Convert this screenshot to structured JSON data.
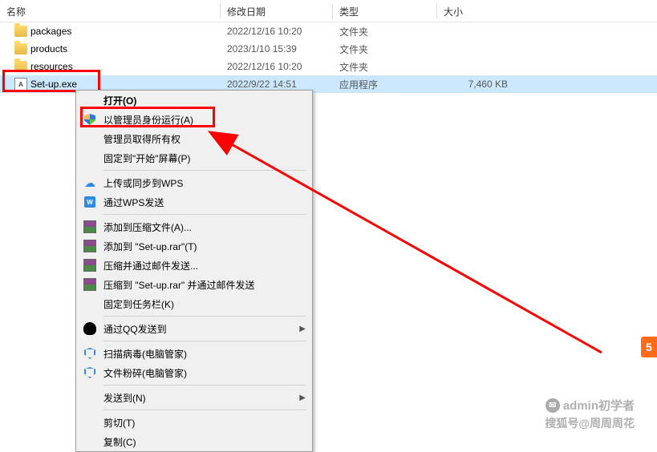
{
  "header": {
    "name": "名称",
    "date": "修改日期",
    "type": "类型",
    "size": "大小"
  },
  "files": [
    {
      "icon": "folder",
      "name": "packages",
      "date": "2022/12/16 10:20",
      "type": "文件夹",
      "size": ""
    },
    {
      "icon": "folder",
      "name": "products",
      "date": "2023/1/10 15:39",
      "type": "文件夹",
      "size": ""
    },
    {
      "icon": "folder",
      "name": "resources",
      "date": "2022/12/16 10:20",
      "type": "文件夹",
      "size": ""
    },
    {
      "icon": "exe",
      "name": "Set-up.exe",
      "date": "2022/9/22 14:51",
      "type": "应用程序",
      "size": "7,460 KB",
      "selected": true
    }
  ],
  "menu": {
    "open": "打开(O)",
    "runas": "以管理员身份运行(A)",
    "ownership": "管理员取得所有权",
    "pin_start": "固定到\"开始\"屏幕(P)",
    "upload_wps": "上传或同步到WPS",
    "send_wps": "通过WPS发送",
    "add_archive": "添加到压缩文件(A)...",
    "add_setup_rar": "添加到 \"Set-up.rar\"(T)",
    "compress_email": "压缩并通过邮件发送...",
    "compress_setup_email": "压缩到 \"Set-up.rar\" 并通过邮件发送",
    "pin_taskbar": "固定到任务栏(K)",
    "qq_send": "通过QQ发送到",
    "virus_scan": "扫描病毒(电脑管家)",
    "file_shred": "文件粉碎(电脑管家)",
    "send_to": "发送到(N)",
    "cut": "剪切(T)",
    "copy": "复制(C)"
  },
  "watermark": {
    "line1_label": "admin初学者",
    "line2": "搜狐号@周周周花"
  },
  "badge": "5"
}
